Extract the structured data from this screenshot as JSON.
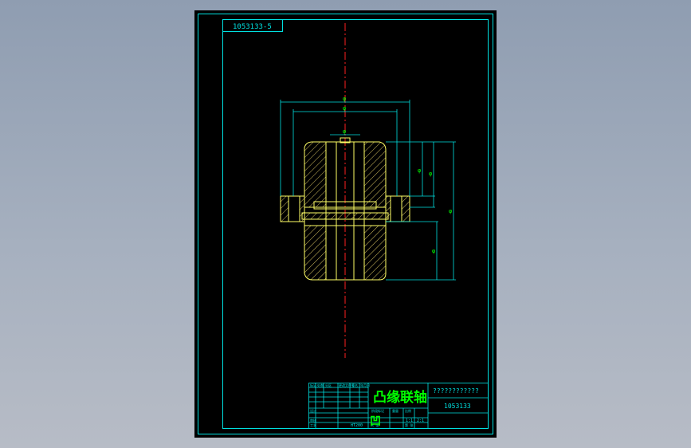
{
  "drawing": {
    "sheet_code": "1053133-5",
    "part_name": "凸缘联轴",
    "drawing_number": "1053133",
    "question_marks": "????????????",
    "dimension_labels": {
      "outer_diameter": "φ",
      "bolt_circle": "φ",
      "hub_bore": "φ",
      "upper_height_1": "φ",
      "upper_height_2": "φ",
      "total_height": "φ",
      "lower_height": "φ"
    },
    "title_block": {
      "row_labels": [
        "标记",
        "设计",
        "审核",
        "工艺"
      ],
      "header_cells": [
        "处数",
        "分区",
        "更改文件号",
        "签名",
        "年月日"
      ],
      "middle_cells": [
        "阶段标记",
        "重量",
        "比例",
        "共 张",
        "第 张"
      ],
      "scale_text": "1:1",
      "stamp_text": "凹",
      "material_text": "HT200",
      "ratio_text": "2:1"
    }
  },
  "colors": {
    "frame": "#00e0e0",
    "outline": "#ffff66",
    "hatch": "#d4c060",
    "centerline": "#ff2020",
    "dimension": "#00e0e0",
    "dim_text": "#00ff00",
    "title_text": "#00ff00"
  }
}
